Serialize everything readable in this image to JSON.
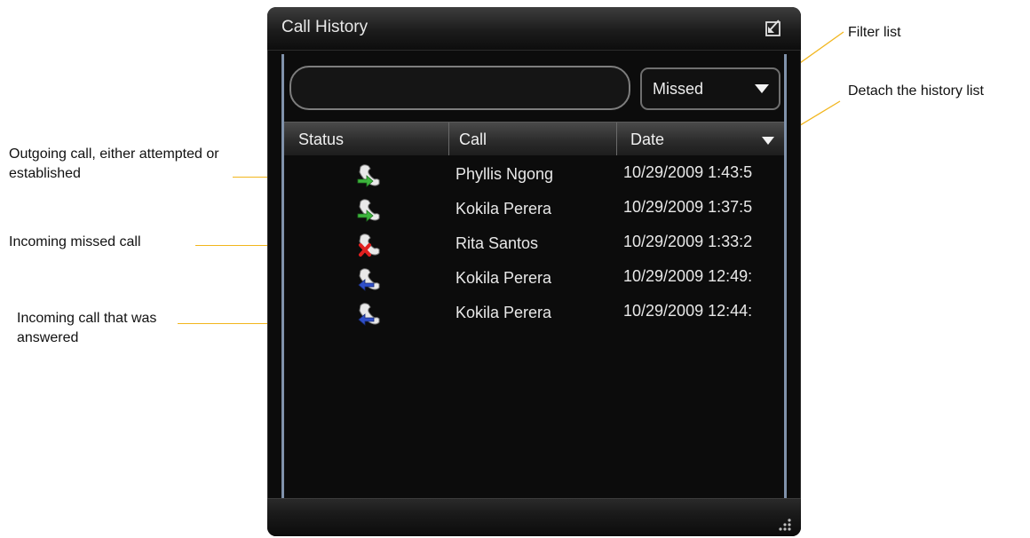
{
  "annotations": {
    "outgoing": "Outgoing call, either attempted or established",
    "missed": "Incoming missed call",
    "answered": "Incoming call that was answered",
    "filter": "Filter list",
    "detach": "Detach the history list"
  },
  "window": {
    "title": "Call History",
    "search": {
      "value": "",
      "placeholder": ""
    },
    "filter": {
      "selected": "Missed"
    },
    "columns": [
      "Status",
      "Call",
      "Date"
    ],
    "rows": [
      {
        "status": "outgoing",
        "name": "Phyllis Ngong",
        "date": "10/29/2009 1:43:5"
      },
      {
        "status": "outgoing",
        "name": "Kokila Perera",
        "date": "10/29/2009 1:37:5"
      },
      {
        "status": "missed",
        "name": "Rita Santos",
        "date": "10/29/2009 1:33:2"
      },
      {
        "status": "incoming",
        "name": "Kokila Perera",
        "date": "10/29/2009 12:49:"
      },
      {
        "status": "incoming",
        "name": "Kokila Perera",
        "date": "10/29/2009 12:44:"
      }
    ]
  },
  "colors": {
    "accent_leader": "#f2b61d",
    "frame_blue": "#8092ab",
    "outgoing_arrow": "#3db53d",
    "missed_x": "#e02020",
    "incoming_arrow": "#2f4fc8"
  },
  "icons": {
    "detach": "detach-window-icon",
    "filter_caret": "chevron-down-icon",
    "sort_caret": "sort-descending-icon",
    "resize": "resize-grip-icon"
  }
}
